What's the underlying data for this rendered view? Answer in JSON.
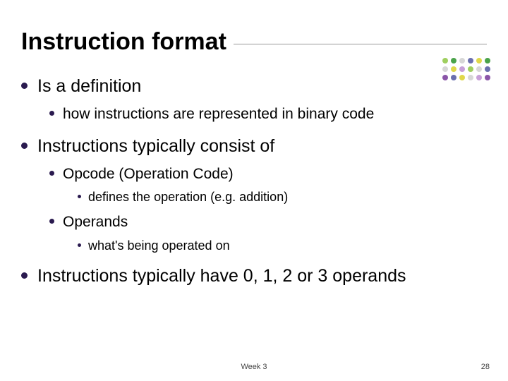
{
  "title": "Instruction format",
  "bullets": [
    {
      "text": "Is a definition",
      "children": [
        {
          "text": "how instructions are represented in binary code"
        }
      ]
    },
    {
      "text": "Instructions typically consist of",
      "children": [
        {
          "text": "Opcode (Operation Code)",
          "children": [
            {
              "text": "defines the operation (e.g. addition)"
            }
          ]
        },
        {
          "text": "Operands",
          "children": [
            {
              "text": "what's being operated on"
            }
          ]
        }
      ]
    },
    {
      "text": "Instructions typically have 0, 1, 2 or 3 operands"
    }
  ],
  "footer": {
    "center": "Week 3",
    "page": "28"
  }
}
